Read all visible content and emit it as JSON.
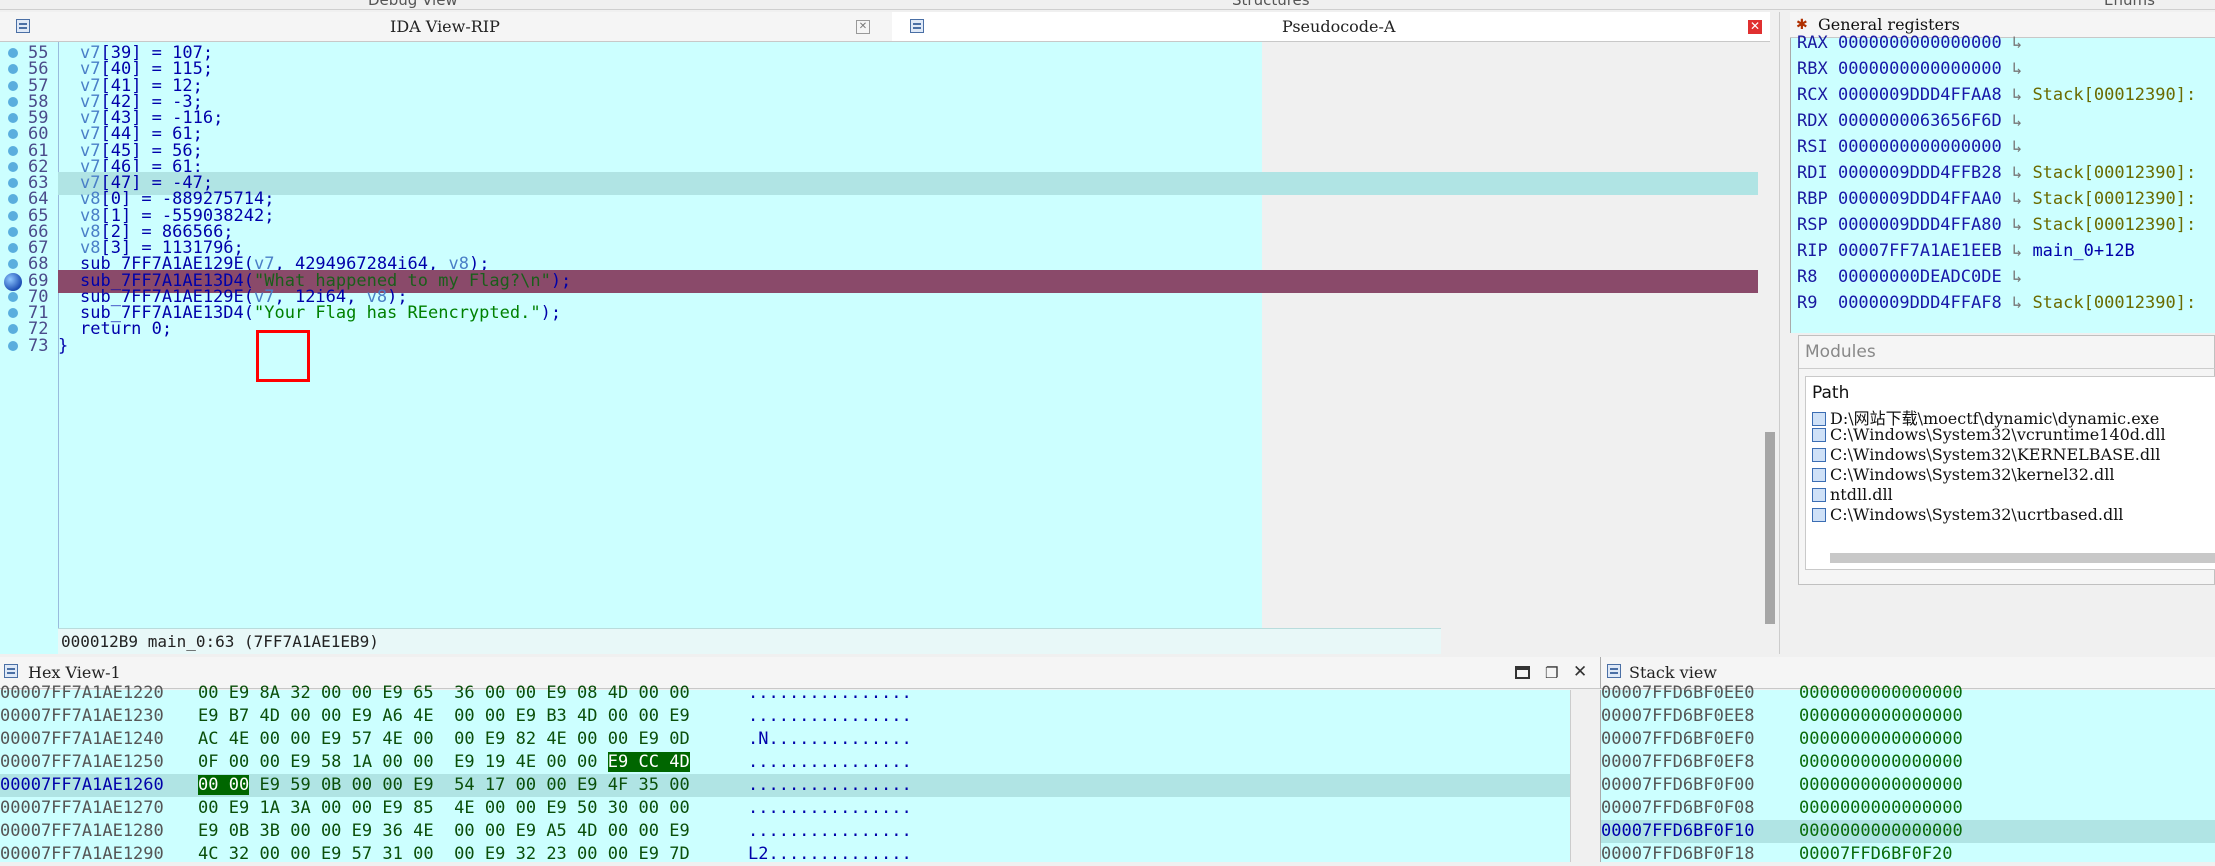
{
  "top_tabs": [
    {
      "label": "Debug View"
    },
    {
      "label": "Structures"
    },
    {
      "label": "Enums"
    }
  ],
  "ida_view": {
    "title": "IDA View-RIP"
  },
  "pseudocode": {
    "title": "Pseudocode-A",
    "lines": [
      {
        "num": "55",
        "code": [
          {
            "t": "v",
            "s": "v7"
          },
          {
            "t": "p",
            "s": "[39] = 107;"
          }
        ]
      },
      {
        "num": "56",
        "code": [
          {
            "t": "v",
            "s": "v7"
          },
          {
            "t": "p",
            "s": "[40] = 115;"
          }
        ]
      },
      {
        "num": "57",
        "code": [
          {
            "t": "v",
            "s": "v7"
          },
          {
            "t": "p",
            "s": "[41] = 12;"
          }
        ]
      },
      {
        "num": "58",
        "code": [
          {
            "t": "v",
            "s": "v7"
          },
          {
            "t": "p",
            "s": "[42] = -3;"
          }
        ]
      },
      {
        "num": "59",
        "code": [
          {
            "t": "v",
            "s": "v7"
          },
          {
            "t": "p",
            "s": "[43] = -116;"
          }
        ]
      },
      {
        "num": "60",
        "code": [
          {
            "t": "v",
            "s": "v7"
          },
          {
            "t": "p",
            "s": "[44] = 61;"
          }
        ]
      },
      {
        "num": "61",
        "code": [
          {
            "t": "v",
            "s": "v7"
          },
          {
            "t": "p",
            "s": "[45] = 56;"
          }
        ]
      },
      {
        "num": "62",
        "code": [
          {
            "t": "v",
            "s": "v7"
          },
          {
            "t": "p",
            "s": "[46] = 61;"
          }
        ]
      },
      {
        "num": "63",
        "code": [
          {
            "t": "v",
            "s": "v7"
          },
          {
            "t": "p",
            "s": "[47] = -47;"
          }
        ],
        "highlight": true
      },
      {
        "num": "64",
        "code": [
          {
            "t": "v",
            "s": "v8"
          },
          {
            "t": "p",
            "s": "[0] = -889275714;"
          }
        ]
      },
      {
        "num": "65",
        "code": [
          {
            "t": "v",
            "s": "v8"
          },
          {
            "t": "p",
            "s": "[1] = -559038242;"
          }
        ]
      },
      {
        "num": "66",
        "code": [
          {
            "t": "v",
            "s": "v8"
          },
          {
            "t": "p",
            "s": "[2] = 866566;"
          }
        ]
      },
      {
        "num": "67",
        "code": [
          {
            "t": "v",
            "s": "v8"
          },
          {
            "t": "p",
            "s": "[3] = 1131796;"
          }
        ]
      },
      {
        "num": "68",
        "code": [
          {
            "t": "p",
            "s": "sub_7FF7A1AE129E("
          },
          {
            "t": "v",
            "s": "v7"
          },
          {
            "t": "p",
            "s": ", 4294967284i64, "
          },
          {
            "t": "v",
            "s": "v8"
          },
          {
            "t": "p",
            "s": ");"
          }
        ]
      },
      {
        "num": "69",
        "code": [
          {
            "t": "p",
            "s": "sub_7FF7A1AE13D4("
          },
          {
            "t": "s",
            "s": "\"What happened to my Flag?\\n\""
          },
          {
            "t": "p",
            "s": ");"
          }
        ],
        "breakpoint": true
      },
      {
        "num": "70",
        "code": [
          {
            "t": "p",
            "s": "sub_7FF7A1AE129E("
          },
          {
            "t": "v",
            "s": "v7"
          },
          {
            "t": "p",
            "s": ", 12i64, "
          },
          {
            "t": "v",
            "s": "v8"
          },
          {
            "t": "p",
            "s": ");"
          }
        ]
      },
      {
        "num": "71",
        "code": [
          {
            "t": "p",
            "s": "sub_7FF7A1AE13D4("
          },
          {
            "t": "s",
            "s": "\"Your Flag has REencrypted.\""
          },
          {
            "t": "p",
            "s": ");"
          }
        ]
      },
      {
        "num": "72",
        "code": [
          {
            "t": "p",
            "s": "return 0;"
          }
        ]
      },
      {
        "num": "73",
        "code": [
          {
            "t": "p",
            "s": "}"
          }
        ],
        "outdent": true
      }
    ],
    "status": "000012B9 main_0:63 (7FF7A1AE1EB9)"
  },
  "registers": {
    "title": "General registers",
    "rows": [
      {
        "name": "RAX",
        "value": "0000000000000000",
        "arrow": "↳",
        "note": ""
      },
      {
        "name": "RBX",
        "value": "0000000000000000",
        "arrow": "↳",
        "note": ""
      },
      {
        "name": "RCX",
        "value": "0000009DDD4FFAA8",
        "arrow": "↳",
        "note": "Stack[00012390]:"
      },
      {
        "name": "RDX",
        "value": "0000000063656F6D",
        "arrow": "↳",
        "note": ""
      },
      {
        "name": "RSI",
        "value": "0000000000000000",
        "arrow": "↳",
        "note": ""
      },
      {
        "name": "RDI",
        "value": "0000009DDD4FFB28",
        "arrow": "↳",
        "note": "Stack[00012390]:"
      },
      {
        "name": "RBP",
        "value": "0000009DDD4FFAA0",
        "arrow": "↳",
        "note": "Stack[00012390]:"
      },
      {
        "name": "RSP",
        "value": "0000009DDD4FFA80",
        "arrow": "↳",
        "note": "Stack[00012390]:"
      },
      {
        "name": "RIP",
        "value": "00007FF7A1AE1EEB",
        "arrow": "↳",
        "note": "main_0+12B"
      },
      {
        "name": "R8 ",
        "value": "00000000DEADC0DE",
        "arrow": "↳",
        "note": ""
      },
      {
        "name": "R9 ",
        "value": "0000009DDD4FFAF8",
        "arrow": "↳",
        "note": "Stack[00012390]:"
      }
    ]
  },
  "modules": {
    "title": "Modules",
    "column": "Path",
    "items": [
      "D:\\网站下载\\moectf\\dynamic\\dynamic.exe",
      "C:\\Windows\\System32\\vcruntime140d.dll",
      "C:\\Windows\\System32\\KERNELBASE.dll",
      "C:\\Windows\\System32\\kernel32.dll",
      "ntdll.dll",
      "C:\\Windows\\System32\\ucrtbased.dll"
    ]
  },
  "hex_view": {
    "title": "Hex View-1",
    "rows": [
      {
        "addr": "00007FF7A1AE1220",
        "bytes": [
          "00",
          "E9",
          "8A",
          "32",
          "00",
          "00",
          "E9",
          "65",
          "36",
          "00",
          "00",
          "E9",
          "08",
          "4D",
          "00",
          "00"
        ],
        "ascii": "................"
      },
      {
        "addr": "00007FF7A1AE1230",
        "bytes": [
          "E9",
          "B7",
          "4D",
          "00",
          "00",
          "E9",
          "A6",
          "4E",
          "00",
          "00",
          "E9",
          "B3",
          "4D",
          "00",
          "00",
          "E9"
        ],
        "ascii": "................"
      },
      {
        "addr": "00007FF7A1AE1240",
        "bytes": [
          "AC",
          "4E",
          "00",
          "00",
          "E9",
          "57",
          "4E",
          "00",
          "00",
          "E9",
          "82",
          "4E",
          "00",
          "00",
          "E9",
          "0D"
        ],
        "ascii": ".N.............."
      },
      {
        "addr": "00007FF7A1AE1250",
        "bytes": [
          "0F",
          "00",
          "00",
          "E9",
          "58",
          "1A",
          "00",
          "00",
          "E9",
          "19",
          "4E",
          "00",
          "00",
          "E9",
          "CC",
          "4D"
        ],
        "ascii": "................",
        "sel_from": 13,
        "sel_to": 15
      },
      {
        "addr": "00007FF7A1AE1260",
        "bytes": [
          "00",
          "00",
          "E9",
          "59",
          "0B",
          "00",
          "00",
          "E9",
          "54",
          "17",
          "00",
          "00",
          "E9",
          "4F",
          "35",
          "00"
        ],
        "ascii": "................",
        "current": true,
        "sel_from": 0,
        "sel_to": 1
      },
      {
        "addr": "00007FF7A1AE1270",
        "bytes": [
          "00",
          "E9",
          "1A",
          "3A",
          "00",
          "00",
          "E9",
          "85",
          "4E",
          "00",
          "00",
          "E9",
          "50",
          "30",
          "00",
          "00"
        ],
        "ascii": "................"
      },
      {
        "addr": "00007FF7A1AE1280",
        "bytes": [
          "E9",
          "0B",
          "3B",
          "00",
          "00",
          "E9",
          "36",
          "4E",
          "00",
          "00",
          "E9",
          "A5",
          "4D",
          "00",
          "00",
          "E9"
        ],
        "ascii": "................"
      },
      {
        "addr": "00007FF7A1AE1290",
        "bytes": [
          "4C",
          "32",
          "00",
          "00",
          "E9",
          "57",
          "31",
          "00",
          "00",
          "E9",
          "32",
          "23",
          "00",
          "00",
          "E9",
          "7D"
        ],
        "ascii": "L2.............."
      }
    ]
  },
  "stack_view": {
    "title": "Stack view",
    "rows": [
      {
        "addr": "00007FFD6BF0EE0",
        "value": "0000000000000000"
      },
      {
        "addr": "00007FFD6BF0EE8",
        "value": "0000000000000000"
      },
      {
        "addr": "00007FFD6BF0EF0",
        "value": "0000000000000000"
      },
      {
        "addr": "00007FFD6BF0EF8",
        "value": "0000000000000000"
      },
      {
        "addr": "00007FFD6BF0F00",
        "value": "0000000000000000"
      },
      {
        "addr": "00007FFD6BF0F08",
        "value": "0000000000000000"
      },
      {
        "addr": "00007FFD6BF0F10",
        "value": "0000000000000000",
        "current": true
      },
      {
        "addr": "00007FFD6BF0F18",
        "value": "00007FFD6BF0F20"
      }
    ]
  },
  "colors": {
    "code_bg": "#ccffff",
    "breakpoint_line": "#8a4a6a",
    "highlight": "#b0e4e4",
    "red_box": "#ff0000"
  }
}
